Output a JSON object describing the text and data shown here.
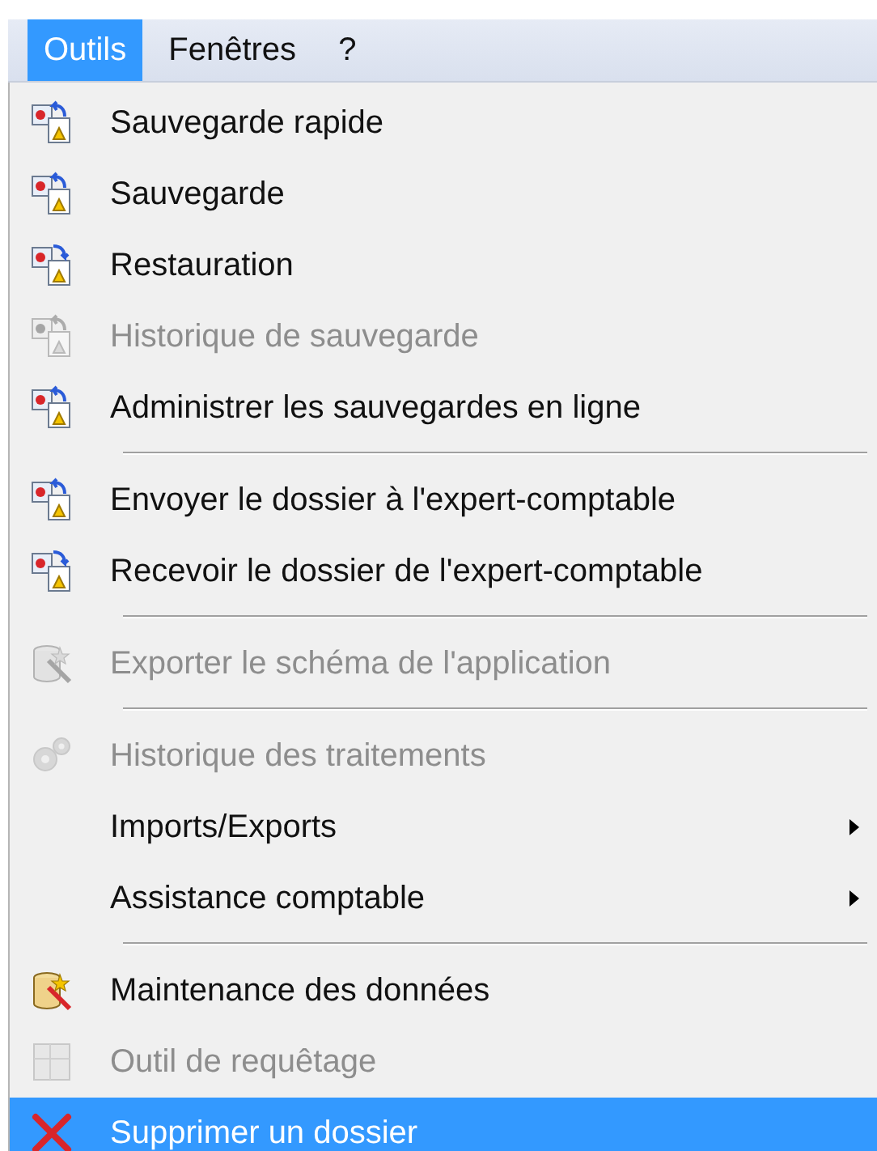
{
  "menubar": [
    {
      "label": "Outils",
      "selected": true
    },
    {
      "label": "Fenêtres",
      "selected": false
    },
    {
      "label": "?",
      "selected": false
    }
  ],
  "menu": [
    {
      "kind": "backup",
      "label": "Sauvegarde rapide",
      "disabled": false,
      "selected": false,
      "submenu": false
    },
    {
      "kind": "backup",
      "label": "Sauvegarde",
      "disabled": false,
      "selected": false,
      "submenu": false
    },
    {
      "kind": "restore",
      "label": "Restauration",
      "disabled": false,
      "selected": false,
      "submenu": false
    },
    {
      "kind": "backup",
      "label": "Historique de sauvegarde",
      "disabled": true,
      "selected": false,
      "submenu": false
    },
    {
      "kind": "backup",
      "label": "Administrer les sauvegardes en ligne",
      "disabled": false,
      "selected": false,
      "submenu": false
    },
    {
      "kind": "separator"
    },
    {
      "kind": "backup",
      "label": "Envoyer le dossier à l'expert-comptable",
      "disabled": false,
      "selected": false,
      "submenu": false
    },
    {
      "kind": "restore",
      "label": "Recevoir le dossier de l'expert-comptable",
      "disabled": false,
      "selected": false,
      "submenu": false
    },
    {
      "kind": "separator"
    },
    {
      "kind": "maintenance",
      "label": "Exporter le schéma de l'application",
      "disabled": true,
      "selected": false,
      "submenu": false
    },
    {
      "kind": "separator"
    },
    {
      "kind": "gears",
      "label": "Historique des traitements",
      "disabled": true,
      "selected": false,
      "submenu": false
    },
    {
      "kind": "plain",
      "label": "Imports/Exports",
      "disabled": false,
      "selected": false,
      "submenu": true
    },
    {
      "kind": "plain",
      "label": "Assistance comptable",
      "disabled": false,
      "selected": false,
      "submenu": true
    },
    {
      "kind": "separator"
    },
    {
      "kind": "maintenance",
      "label": "Maintenance des données",
      "disabled": false,
      "selected": false,
      "submenu": false
    },
    {
      "kind": "grid",
      "label": "Outil de requêtage",
      "disabled": true,
      "selected": false,
      "submenu": false
    },
    {
      "kind": "delete",
      "label": "Supprimer un dossier",
      "disabled": false,
      "selected": true,
      "submenu": false
    }
  ]
}
